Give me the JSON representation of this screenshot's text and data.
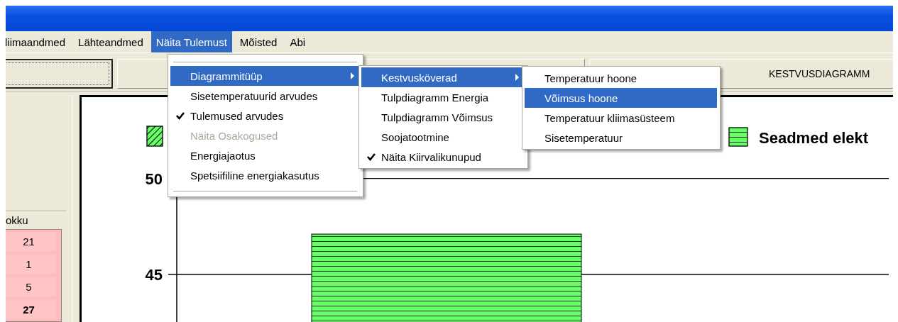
{
  "menu_bar": {
    "items": [
      {
        "label": "liimaandmed",
        "selected": false
      },
      {
        "label": "Lähteandmed",
        "selected": false
      },
      {
        "label": "Näita Tulemust",
        "selected": true
      },
      {
        "label": "Mõisted",
        "selected": false
      },
      {
        "label": "Abi",
        "selected": false
      }
    ]
  },
  "toolbar": {
    "panel_label": "KESTVUSDIAGRAMM"
  },
  "side_table": {
    "header": "okku",
    "cells": [
      {
        "text": "21",
        "bold": false
      },
      {
        "text": "1",
        "bold": false
      },
      {
        "text": "5",
        "bold": false
      },
      {
        "text": "27",
        "bold": true
      }
    ]
  },
  "chart": {
    "chart_data": {
      "type": "bar",
      "ylim": [
        42.4,
        50.1
      ],
      "yticks": [
        45,
        50
      ],
      "series": [
        {
          "color": "#66ff66",
          "values": [
            null
          ]
        },
        {
          "name": "Seadmed elekt",
          "color": "#66ff66",
          "values": [
            47.1
          ]
        }
      ]
    }
  },
  "menus": [
    {
      "items": [
        {
          "label": "Diagrammitüüp",
          "selected": true,
          "checked": false,
          "disabled": false,
          "has_submenu": true
        },
        {
          "label": "Sisetemperatuurid arvudes",
          "selected": false,
          "checked": false,
          "disabled": false,
          "has_submenu": false
        },
        {
          "label": "Tulemused arvudes",
          "selected": false,
          "checked": true,
          "disabled": false,
          "has_submenu": false
        },
        {
          "label": "Näita Osakogused",
          "selected": false,
          "checked": false,
          "disabled": true,
          "has_submenu": false
        },
        {
          "label": "Energiajaotus",
          "selected": false,
          "checked": false,
          "disabled": false,
          "has_submenu": false
        },
        {
          "label": "Spetsiifiline energiakasutus",
          "selected": false,
          "checked": false,
          "disabled": false,
          "has_submenu": false
        }
      ]
    },
    {
      "items": [
        {
          "label": "Kestvusköverad",
          "selected": true,
          "checked": false,
          "disabled": false,
          "has_submenu": true
        },
        {
          "label": "Tulpdiagramm Energia",
          "selected": false,
          "checked": false,
          "disabled": false,
          "has_submenu": false
        },
        {
          "label": "Tulpdiagramm Võimsus",
          "selected": false,
          "checked": false,
          "disabled": false,
          "has_submenu": false
        },
        {
          "label": "Soojatootmine",
          "selected": false,
          "checked": false,
          "disabled": false,
          "has_submenu": false
        },
        {
          "label": "Näita Kiirvalikunupud",
          "selected": false,
          "checked": true,
          "disabled": false,
          "has_submenu": false
        }
      ]
    },
    {
      "items": [
        {
          "label": "Temperatuur hoone",
          "selected": false,
          "checked": false,
          "disabled": false,
          "has_submenu": false
        },
        {
          "label": "Võimsus hoone",
          "selected": true,
          "checked": false,
          "disabled": false,
          "has_submenu": false
        },
        {
          "label": "Temperatuur kliimasüsteem",
          "selected": false,
          "checked": false,
          "disabled": false,
          "has_submenu": false
        },
        {
          "label": "Sisetemperatuur",
          "selected": false,
          "checked": false,
          "disabled": false,
          "has_submenu": false
        }
      ]
    }
  ]
}
